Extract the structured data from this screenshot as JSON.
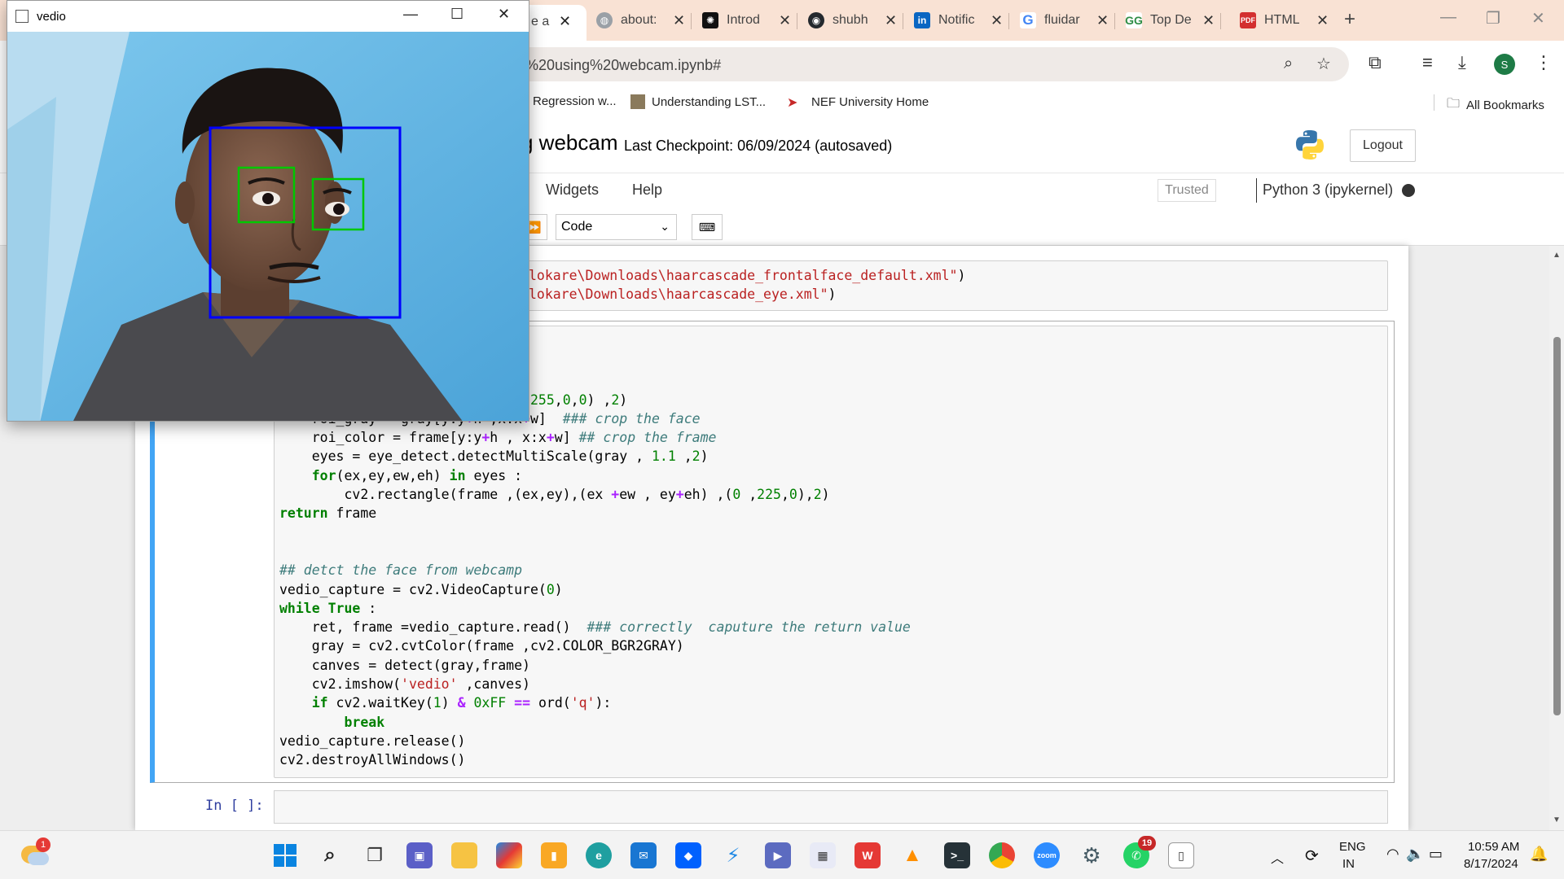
{
  "browser": {
    "tabs": [
      {
        "title": "about:",
        "favicon": "globe-icon",
        "color": "#9aa0a6"
      },
      {
        "title": "Introd",
        "favicon": "openai-icon",
        "color": "#111111"
      },
      {
        "title": "shubh",
        "favicon": "github-icon",
        "color": "#24292e"
      },
      {
        "title": "Notific",
        "favicon": "linkedin-icon",
        "color": "#0a66c2"
      },
      {
        "title": "fluidar",
        "favicon": "google-icon",
        "color": "#4285f4"
      },
      {
        "title": "Top De",
        "favicon": "geeks-icon",
        "color": "#2f8d46"
      },
      {
        "title": "HTML",
        "favicon": "pdf-icon",
        "color": "#d32f2f"
      }
    ],
    "active_tab_partial": "e a",
    "url": "%20using%20webcam.ipynb#",
    "bookmarks": [
      {
        "label": "Regression w...",
        "icon": "bookmark-icon"
      },
      {
        "label": "Understanding LST...",
        "icon": "bookmark-icon"
      },
      {
        "label": "NEF University Home",
        "icon": "nef-icon"
      }
    ],
    "all_bookmarks_label": "All Bookmarks",
    "profile_initial": "S"
  },
  "jupyter": {
    "title_partial": "g webcam",
    "last_checkpoint": "Last Checkpoint: 06/09/2024  (autosaved)",
    "logout_label": "Logout",
    "menus": [
      "Widgets",
      "Help"
    ],
    "trusted_label": "Trusted",
    "kernel_label": "Python 3 (ipykernel)",
    "cell_type": "Code",
    "prompt_label": "In [ ]:"
  },
  "cam_window": {
    "title": "vedio"
  },
  "taskbar": {
    "weather_badge": "1",
    "language": "ENG",
    "region": "IN",
    "time": "10:59 AM",
    "date": "8/17/2024",
    "whatsapp_badge": "19"
  },
  "colors": {
    "accent_blue": "#42a5f5",
    "face_box": "#0000ff",
    "eye_box": "#00c800"
  }
}
